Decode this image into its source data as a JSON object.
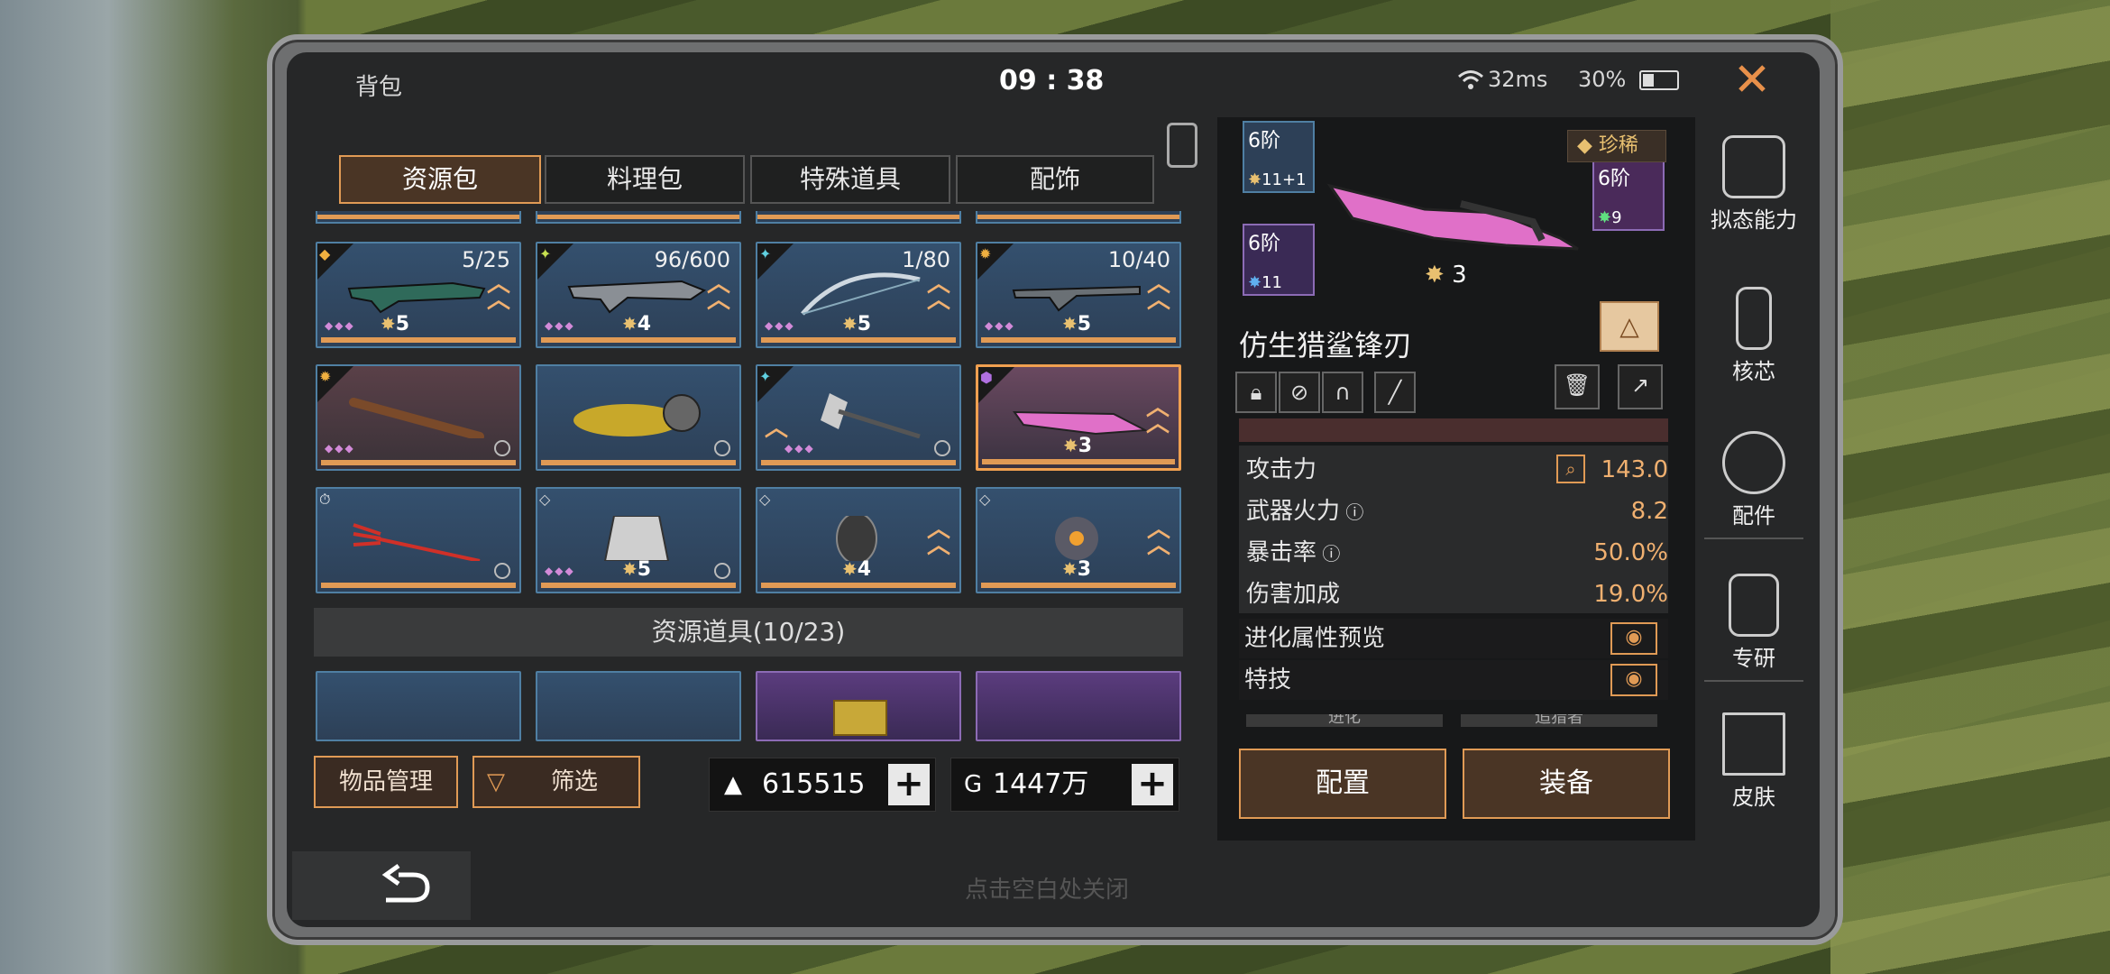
{
  "status": {
    "title": "背包",
    "time": "09 : 38",
    "ping": "32ms",
    "battery": "30%"
  },
  "tabs": [
    "资源包",
    "料理包",
    "特殊道具",
    "配饰"
  ],
  "grid": {
    "row1": [
      {
        "count": "5/25",
        "level": "5"
      },
      {
        "count": "96/600",
        "level": "4"
      },
      {
        "count": "1/80",
        "level": "5"
      },
      {
        "count": "10/40",
        "level": "5"
      }
    ],
    "row2": [
      {
        "level": ""
      },
      {
        "level": ""
      },
      {
        "level": ""
      },
      {
        "level": "3"
      }
    ],
    "row3": [
      {
        "level": ""
      },
      {
        "level": "5"
      },
      {
        "level": "4"
      },
      {
        "level": "3"
      }
    ]
  },
  "section_header": "资源道具(10/23)",
  "bottom": {
    "manage": "物品管理",
    "filter": "筛选",
    "currency1": "615515",
    "currency2": "1447万",
    "close_hint": "点击空白处关闭"
  },
  "detail": {
    "tier_badge_1": "6阶",
    "tier1_val": "11+1",
    "tier_badge_2": "6阶",
    "tier2_val": "11",
    "tier_badge_3": "6阶",
    "tier3_val": "9",
    "rarity": "珍稀",
    "star_level": "3",
    "name": "仿生猎鲨锋刃",
    "stats": [
      {
        "label": "攻击力",
        "value": "143.0"
      },
      {
        "label": "武器火力",
        "value": "8.2"
      },
      {
        "label": "暴击率",
        "value": "50.0%"
      },
      {
        "label": "伤害加成",
        "value": "19.0%"
      }
    ],
    "evo_preview": "进化属性预览",
    "skill": "特技",
    "partial1": "进化",
    "partial2": "追猎者",
    "config": "配置",
    "equip": "装备"
  },
  "sidebar": [
    "拟态能力",
    "核芯",
    "配件",
    "专研",
    "皮肤"
  ],
  "colors": {
    "accent": "#e09a55",
    "panel": "#262728",
    "cell": "#34506e"
  }
}
